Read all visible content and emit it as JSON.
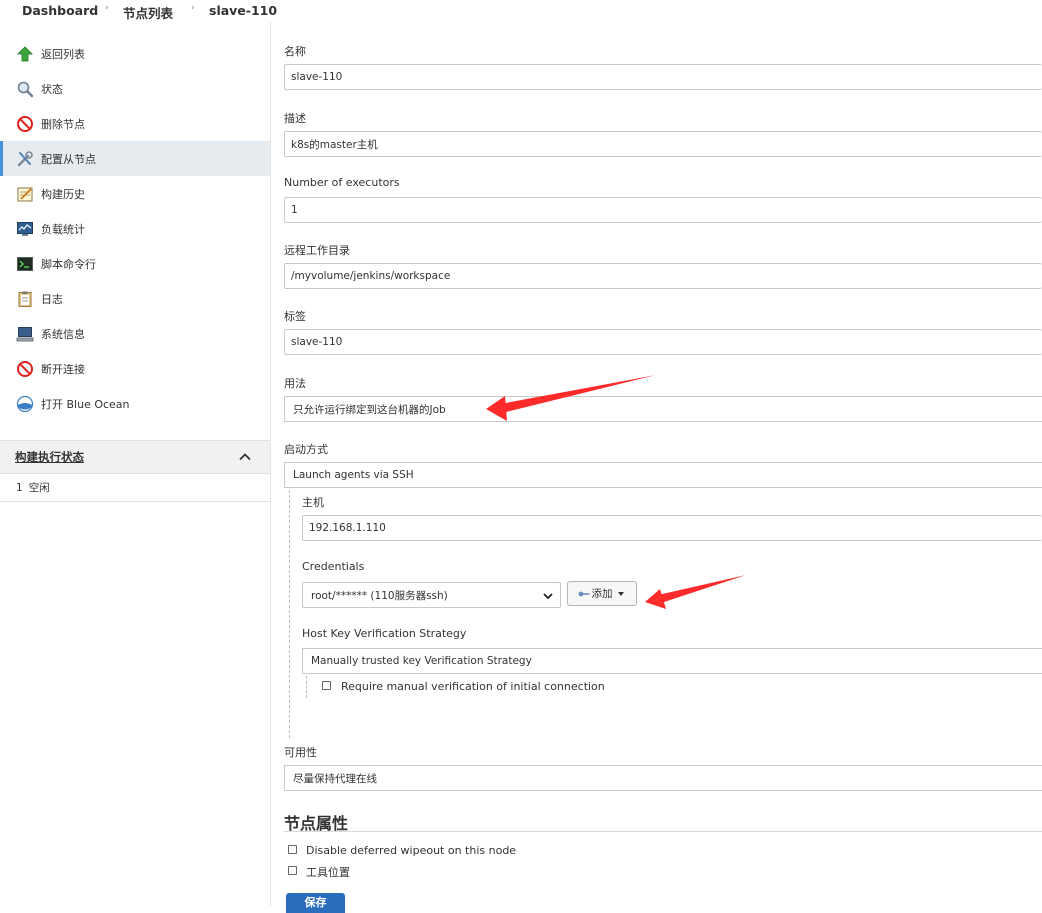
{
  "breadcrumb": {
    "items": [
      "Dashboard",
      "节点列表",
      "slave-110"
    ]
  },
  "sidebar": {
    "items": [
      {
        "label": "返回列表",
        "icon": "up-arrow-icon"
      },
      {
        "label": "状态",
        "icon": "magnifier-icon"
      },
      {
        "label": "删除节点",
        "icon": "no-entry-icon"
      },
      {
        "label": "配置从节点",
        "icon": "wrench-screwdriver-icon",
        "active": true
      },
      {
        "label": "构建历史",
        "icon": "notepad-icon"
      },
      {
        "label": "负载统计",
        "icon": "monitor-chart-icon"
      },
      {
        "label": "脚本命令行",
        "icon": "terminal-icon"
      },
      {
        "label": "日志",
        "icon": "clipboard-icon"
      },
      {
        "label": "系统信息",
        "icon": "computer-icon"
      },
      {
        "label": "断开连接",
        "icon": "no-entry-icon"
      },
      {
        "label": "打开 Blue Ocean",
        "icon": "blue-ocean-icon"
      }
    ]
  },
  "executors": {
    "header": "构建执行状态",
    "rows": [
      {
        "number": "1",
        "status": "空闲"
      }
    ]
  },
  "form": {
    "name": {
      "label": "名称",
      "value": "slave-110"
    },
    "description": {
      "label": "描述",
      "value": "k8s的master主机"
    },
    "executors": {
      "label": "Number of executors",
      "value": "1"
    },
    "remote_dir": {
      "label": "远程工作目录",
      "value": "/myvolume/jenkins/workspace"
    },
    "labels": {
      "label": "标签",
      "value": "slave-110"
    },
    "usage": {
      "label": "用法",
      "value": "只允许运行绑定到这台机器的Job"
    },
    "launch": {
      "label": "启动方式",
      "value": "Launch agents via SSH"
    },
    "host": {
      "label": "主机",
      "value": "192.168.1.110"
    },
    "credentials": {
      "label": "Credentials",
      "value": "root/****** (110服务器ssh)",
      "add_label": "添加"
    },
    "host_key": {
      "label": "Host Key Verification Strategy",
      "value": "Manually trusted key Verification Strategy",
      "require_manual": "Require manual verification of initial connection"
    },
    "availability": {
      "label": "可用性",
      "value": "尽量保持代理在线"
    }
  },
  "node_properties": {
    "title": "节点属性",
    "options": [
      "Disable deferred wipeout on this node",
      "工具位置"
    ]
  },
  "save_label": "保存",
  "colors": {
    "sidebar_active_bg": "#e6ebef",
    "accent": "#4a90d9",
    "annotation_arrow": "#ff2a2a",
    "save_button": "#2a6ebb"
  }
}
